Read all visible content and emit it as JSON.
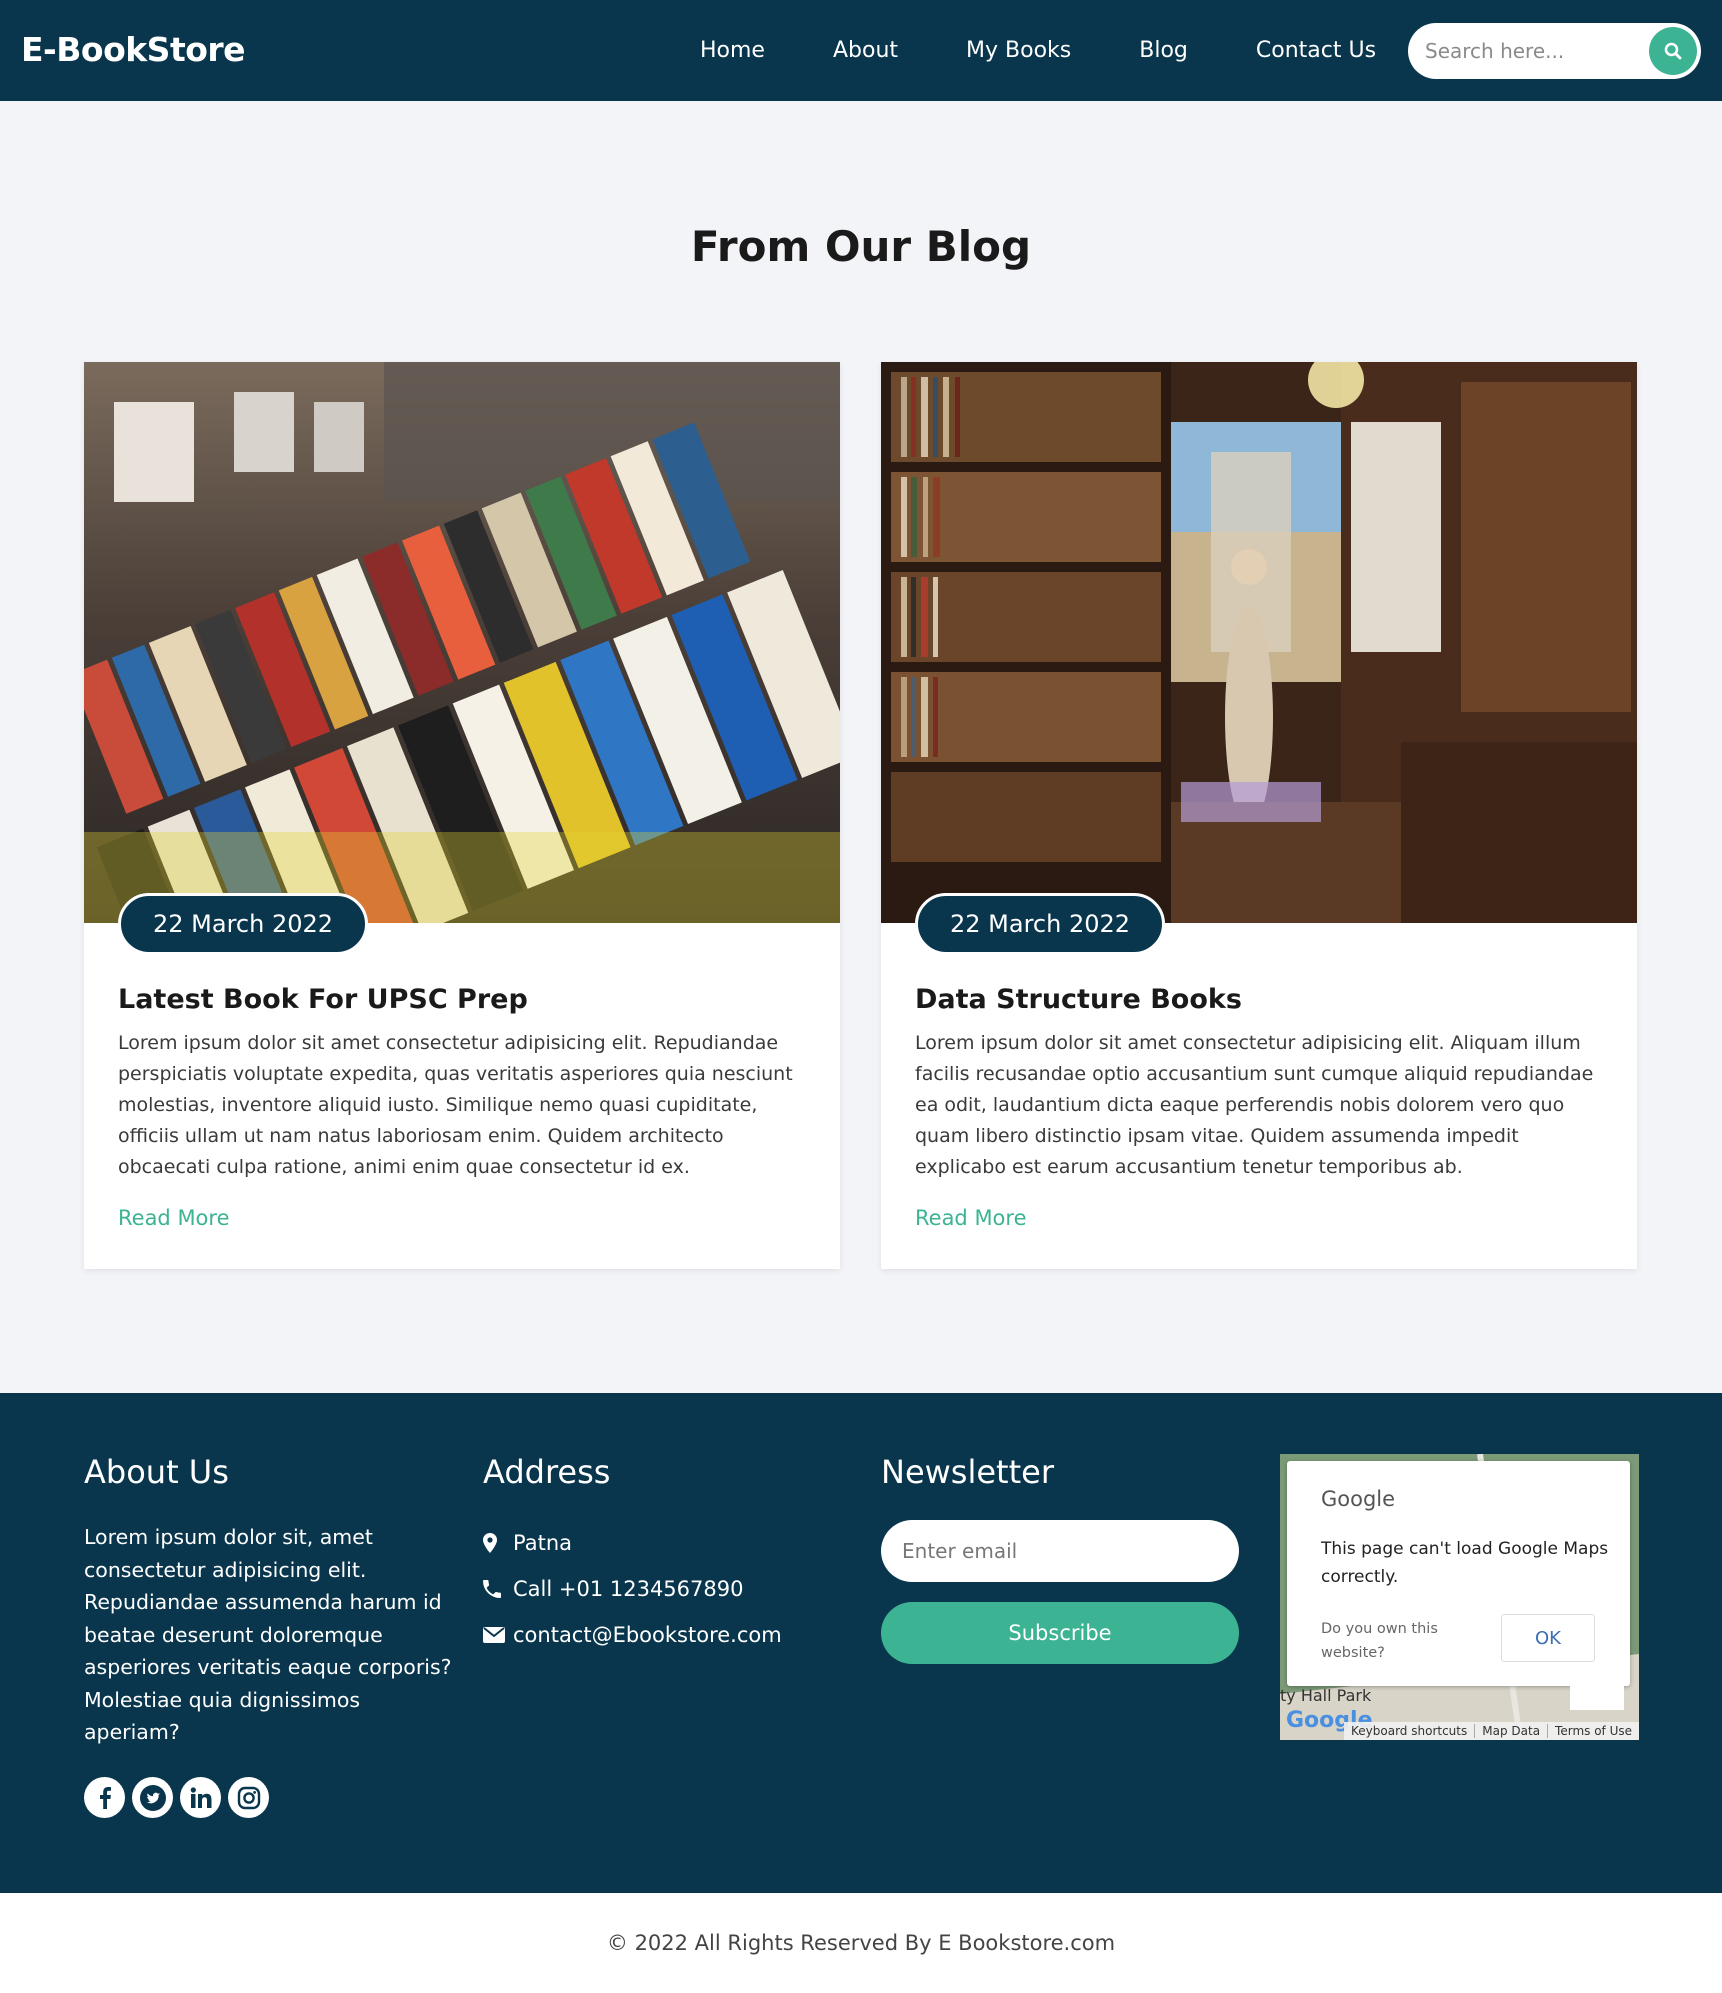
{
  "navbar": {
    "brand": "E-BookStore",
    "links": [
      "Home",
      "About",
      "My Books",
      "Blog",
      "Contact Us"
    ],
    "search_placeholder": "Search here...",
    "search_icon": "search-icon"
  },
  "blog": {
    "title": "From Our Blog",
    "posts": [
      {
        "image": "book-stall-photo",
        "date": "22 March 2022",
        "title": "Latest Book For UPSC Prep",
        "text": "Lorem ipsum dolor sit amet consectetur adipisicing elit. Repudiandae perspiciatis voluptate expedita, quas veritatis asperiores quia nesciunt molestias, inventore aliquid iusto. Similique nemo quasi cupiditate, officiis ullam ut nam natus laboriosam enim. Quidem architecto obcaecati culpa ratione, animi enim quae consectetur id ex.",
        "link": "Read More"
      },
      {
        "image": "bookshop-interior-photo",
        "date": "22 March 2022",
        "title": "Data Structure Books",
        "text": "Lorem ipsum dolor sit amet consectetur adipisicing elit. Aliquam illum facilis recusandae optio accusantium sunt cumque aliquid repudiandae ea odit, laudantium dicta eaque perferendis nobis dolorem vero quo quam libero distinctio ipsam vitae. Quidem assumenda impedit explicabo est earum accusantium tenetur temporibus ab.",
        "link": "Read More"
      }
    ]
  },
  "footer": {
    "about": {
      "heading": "About Us",
      "text": "Lorem ipsum dolor sit, amet consectetur adipisicing elit. Repudiandae assumenda harum id beatae deserunt doloremque asperiores veritatis eaque corporis? Molestiae quia dignissimos aperiam?",
      "socials": [
        "facebook-icon",
        "twitter-icon",
        "linkedin-icon",
        "instagram-icon"
      ]
    },
    "address": {
      "heading": "Address",
      "city": "Patna",
      "phone": "Call +01 1234567890",
      "email": "contact@Ebookstore.com"
    },
    "newsletter": {
      "heading": "Newsletter",
      "email_placeholder": "Enter email",
      "button": "Subscribe"
    },
    "map": {
      "provider": "Google",
      "message": "This page can't load Google Maps correctly.",
      "owner_question": "Do you own this website?",
      "ok": "OK",
      "park_label": "ty Hall Park",
      "logo_text": "Google",
      "bar": [
        "Keyboard shortcuts",
        "Map Data",
        "Terms of Use"
      ]
    }
  },
  "copyright": "© 2022 All Rights Reserved By E Bookstore.com",
  "colors": {
    "navy": "#09364c",
    "accent": "#3cb393",
    "page_bg": "#f3f4f8"
  }
}
